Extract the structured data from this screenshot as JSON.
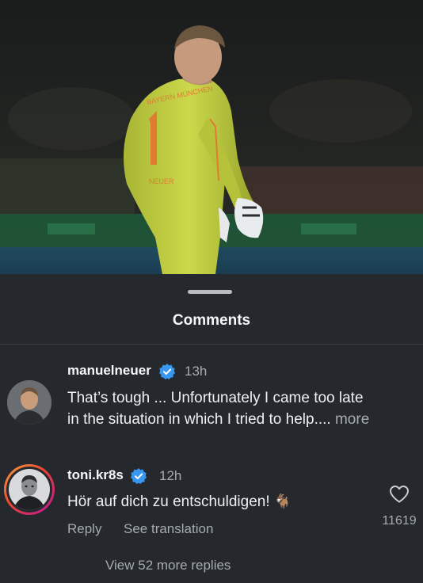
{
  "sheet": {
    "title": "Comments"
  },
  "comments": [
    {
      "username": "manuelneuer",
      "verified": true,
      "time": "13h",
      "text_line1": "That’s tough ... Unfortunately I came too late",
      "text_line2": "in the situation in which I tried to help....",
      "more_label": "more"
    },
    {
      "username": "toni.kr8s",
      "verified": true,
      "time": "12h",
      "text": "Hör auf dich zu entschuldigen!",
      "emoji": "🐐",
      "reply_label": "Reply",
      "translate_label": "See translation",
      "like_count": "11619",
      "view_replies_label": "View 52 more replies"
    }
  ],
  "colors": {
    "background": "#25292e",
    "verified_badge": "#3897f0",
    "story_ring_start": "#f9a23a",
    "story_ring_end": "#c013a0",
    "jersey": "#c7d43e"
  },
  "icons": [
    "verified-badge-icon",
    "heart-icon",
    "goat-emoji"
  ]
}
